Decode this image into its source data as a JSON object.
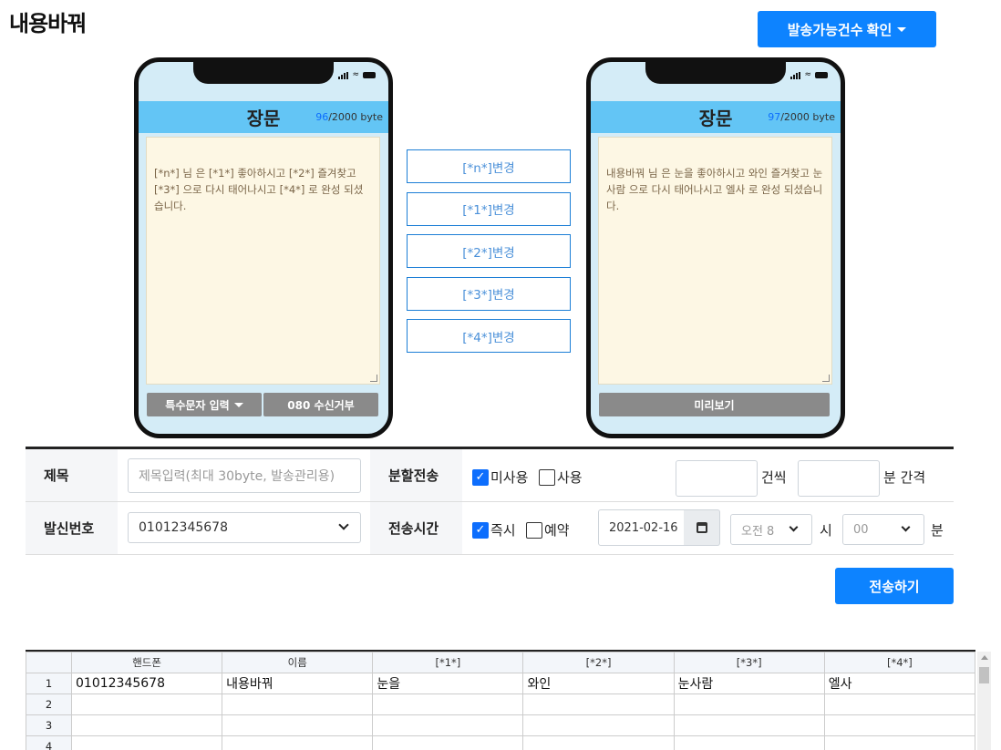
{
  "page": {
    "title": "내용바꿔",
    "count_button": "발송가능건수 확인"
  },
  "phone_left": {
    "title": "장문",
    "bytes_used": "96",
    "bytes_total": "/2000 byte",
    "message": "[*n*] 님 은 [*1*] 좋아하시고 [*2*] 즐겨찾고 [*3*] 으로 다시 태어나시고 [*4*] 로 완성 되셨습니다.",
    "btn_special": "특수문자 입력",
    "btn_reject": "080 수신거부"
  },
  "phone_right": {
    "title": "장문",
    "bytes_used": "97",
    "bytes_total": "/2000 byte",
    "message": "내용바꿔 님 은 눈을 좋아하시고 와인 즐겨찾고 눈사람 으로 다시 태어나시고 엘사 로 완성 되셨습니다.",
    "btn_preview": "미리보기"
  },
  "change_buttons": [
    "[*n*]변경",
    "[*1*]변경",
    "[*2*]변경",
    "[*3*]변경",
    "[*4*]변경"
  ],
  "form": {
    "subject_label": "제목",
    "subject_placeholder": "제목입력(최대 30byte, 발송관리용)",
    "split_label": "분할전송",
    "split_off": "미사용",
    "split_on": "사용",
    "split_count_unit": "건씩",
    "split_interval_unit": "분 간격",
    "sender_label": "발신번호",
    "sender_value": "01012345678",
    "time_label": "전송시간",
    "time_now": "즉시",
    "time_reserve": "예약",
    "date_value": "2021-02-16",
    "hour_value": "오전 8",
    "hour_unit": "시",
    "minute_value": "00",
    "minute_unit": "분"
  },
  "send_button": "전송하기",
  "grid": {
    "headers": [
      "핸드폰",
      "이름",
      "[*1*]",
      "[*2*]",
      "[*3*]",
      "[*4*]"
    ],
    "rows": [
      {
        "idx": "1",
        "cells": [
          "01012345678",
          "내용바꿔",
          "눈을",
          "와인",
          "눈사람",
          "엘사"
        ]
      },
      {
        "idx": "2",
        "cells": [
          "",
          "",
          "",
          "",
          "",
          ""
        ]
      },
      {
        "idx": "3",
        "cells": [
          "",
          "",
          "",
          "",
          "",
          ""
        ]
      },
      {
        "idx": "4",
        "cells": [
          "",
          "",
          "",
          "",
          "",
          ""
        ]
      }
    ]
  },
  "colors": {
    "accent": "#0d83ff",
    "phone_header": "#63c5f5",
    "message_bg": "#fdf7e4"
  }
}
